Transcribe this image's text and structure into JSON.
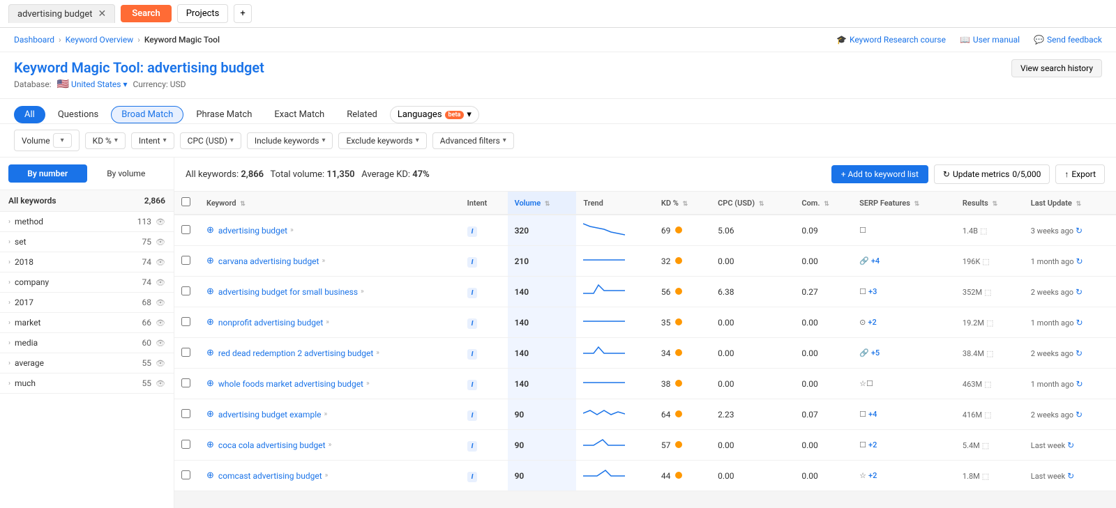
{
  "topBar": {
    "searchText": "advertising budget",
    "searchBtnLabel": "Search",
    "projectsBtnLabel": "Projects",
    "plusBtnLabel": "+"
  },
  "breadcrumb": {
    "items": [
      "Dashboard",
      "Keyword Overview",
      "Keyword Magic Tool"
    ]
  },
  "topLinks": {
    "course": "Keyword Research course",
    "manual": "User manual",
    "feedback": "Send feedback"
  },
  "pageHeader": {
    "title": "Keyword Magic Tool:",
    "keyword": "advertising budget",
    "dbLabel": "Database:",
    "dbValue": "United States",
    "currency": "Currency: USD",
    "viewHistory": "View search history"
  },
  "tabs": {
    "all": "All",
    "questions": "Questions",
    "broadMatch": "Broad Match",
    "phraseMatch": "Phrase Match",
    "exactMatch": "Exact Match",
    "related": "Related",
    "languages": "Languages",
    "beta": "beta"
  },
  "filters": {
    "volume": "Volume",
    "kd": "KD %",
    "intent": "Intent",
    "cpc": "CPC (USD)",
    "includeKeywords": "Include keywords",
    "excludeKeywords": "Exclude keywords",
    "advancedFilters": "Advanced filters"
  },
  "sidebar": {
    "byNumber": "By number",
    "byVolume": "By volume",
    "allKeywords": "All keywords",
    "allCount": "2,866",
    "items": [
      {
        "label": "method",
        "count": "113"
      },
      {
        "label": "set",
        "count": "75"
      },
      {
        "label": "2018",
        "count": "74"
      },
      {
        "label": "company",
        "count": "74"
      },
      {
        "label": "2017",
        "count": "68"
      },
      {
        "label": "market",
        "count": "66"
      },
      {
        "label": "media",
        "count": "60"
      },
      {
        "label": "average",
        "count": "55"
      },
      {
        "label": "much",
        "count": "55"
      }
    ]
  },
  "summary": {
    "allKeywordsLabel": "All keywords:",
    "count": "2,866",
    "volumeLabel": "Total volume:",
    "volume": "11,350",
    "kdLabel": "Average KD:",
    "kd": "47%"
  },
  "actions": {
    "addToList": "+ Add to keyword list",
    "updateMetrics": "Update metrics",
    "updateCount": "0/5,000",
    "export": "Export"
  },
  "tableColumns": [
    "",
    "Keyword",
    "Intent",
    "Volume",
    "Trend",
    "KD %",
    "CPC (USD)",
    "Com.",
    "SERP Features",
    "Results",
    "Last Update"
  ],
  "rows": [
    {
      "keyword": "advertising budget",
      "intent": "I",
      "volume": "320",
      "kd": "69",
      "kdColor": "orange",
      "cpc": "5.06",
      "com": "0.09",
      "serpFeatures": "☐",
      "serpExtra": "",
      "results": "1.4B",
      "lastUpdate": "3 weeks ago",
      "trend": "down"
    },
    {
      "keyword": "carvana advertising budget",
      "intent": "I",
      "volume": "210",
      "kd": "32",
      "kdColor": "orange",
      "cpc": "0.00",
      "com": "0.00",
      "serpFeatures": "🔗",
      "serpExtra": "+4",
      "results": "196K",
      "lastUpdate": "1 month ago",
      "trend": "flat"
    },
    {
      "keyword": "advertising budget for small business",
      "intent": "I",
      "volume": "140",
      "kd": "56",
      "kdColor": "orange",
      "cpc": "6.38",
      "com": "0.27",
      "serpFeatures": "☐",
      "serpExtra": "+3",
      "results": "352M",
      "lastUpdate": "2 weeks ago",
      "trend": "spike"
    },
    {
      "keyword": "nonprofit advertising budget",
      "intent": "I",
      "volume": "140",
      "kd": "35",
      "kdColor": "orange",
      "cpc": "0.00",
      "com": "0.00",
      "serpFeatures": "⊙",
      "serpExtra": "+2",
      "results": "19.2M",
      "lastUpdate": "1 month ago",
      "trend": "flat"
    },
    {
      "keyword": "red dead redemption 2 advertising budget",
      "intent": "I",
      "volume": "140",
      "kd": "34",
      "kdColor": "orange",
      "cpc": "0.00",
      "com": "0.00",
      "serpFeatures": "🔗",
      "serpExtra": "+5",
      "results": "38.4M",
      "lastUpdate": "2 weeks ago",
      "trend": "spike2"
    },
    {
      "keyword": "whole foods market advertising budget",
      "intent": "I",
      "volume": "140",
      "kd": "38",
      "kdColor": "orange",
      "cpc": "0.00",
      "com": "0.00",
      "serpFeatures": "☆☐",
      "serpExtra": "",
      "results": "463M",
      "lastUpdate": "1 month ago",
      "trend": "flat"
    },
    {
      "keyword": "advertising budget example",
      "intent": "I",
      "volume": "90",
      "kd": "64",
      "kdColor": "orange",
      "cpc": "2.23",
      "com": "0.07",
      "serpFeatures": "☐",
      "serpExtra": "+4",
      "results": "416M",
      "lastUpdate": "2 weeks ago",
      "trend": "wavy"
    },
    {
      "keyword": "coca cola advertising budget",
      "intent": "I",
      "volume": "90",
      "kd": "57",
      "kdColor": "orange",
      "cpc": "0.00",
      "com": "0.00",
      "serpFeatures": "☐",
      "serpExtra": "+2",
      "results": "5.4M",
      "lastUpdate": "Last week",
      "trend": "spike3"
    },
    {
      "keyword": "comcast advertising budget",
      "intent": "I",
      "volume": "90",
      "kd": "44",
      "kdColor": "orange",
      "cpc": "0.00",
      "com": "0.00",
      "serpFeatures": "☆",
      "serpExtra": "+2",
      "results": "1.8M",
      "lastUpdate": "Last week",
      "trend": "spike4"
    }
  ]
}
